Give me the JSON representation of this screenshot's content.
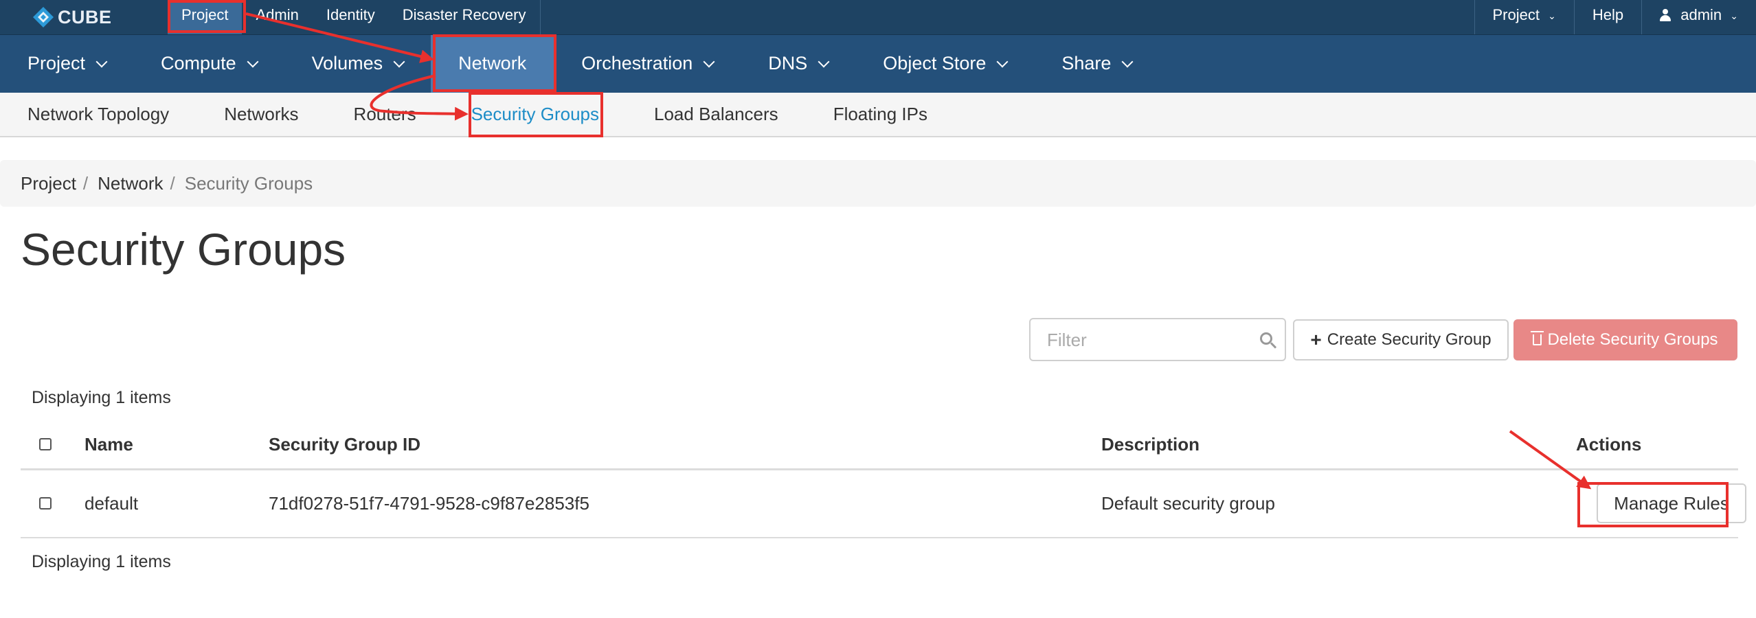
{
  "brand": {
    "name": "CUBE"
  },
  "topbar": {
    "left_items": [
      "Project",
      "Admin",
      "Identity",
      "Disaster Recovery"
    ],
    "project_menu": "Project",
    "help": "Help",
    "user": "admin"
  },
  "mainnav": {
    "items": [
      {
        "label": "Project"
      },
      {
        "label": "Compute"
      },
      {
        "label": "Volumes"
      },
      {
        "label": "Network"
      },
      {
        "label": "Orchestration"
      },
      {
        "label": "DNS"
      },
      {
        "label": "Object Store"
      },
      {
        "label": "Share"
      }
    ]
  },
  "subnav": {
    "items": [
      "Network Topology",
      "Networks",
      "Routers",
      "Security Groups",
      "Load Balancers",
      "Floating IPs"
    ]
  },
  "breadcrumb": [
    "Project",
    "Network",
    "Security Groups"
  ],
  "page": {
    "title": "Security Groups"
  },
  "toolbar": {
    "filter_placeholder": "Filter",
    "create_label": "Create Security Group",
    "delete_label": "Delete Security Groups"
  },
  "table": {
    "count_text": "Displaying 1 items",
    "headers": {
      "name": "Name",
      "id": "Security Group ID",
      "description": "Description",
      "actions": "Actions"
    },
    "rows": [
      {
        "name": "default",
        "id": "71df0278-51f7-4791-9528-c9f87e2853f5",
        "description": "Default security group",
        "action": "Manage Rules"
      }
    ]
  },
  "colors": {
    "topbar": "#1e4363",
    "mainnav": "#24507a",
    "mainnav_active": "#4a7bae",
    "link_active": "#1d8dc7",
    "delete_button": "#e88887",
    "annotation": "#e8302d"
  }
}
